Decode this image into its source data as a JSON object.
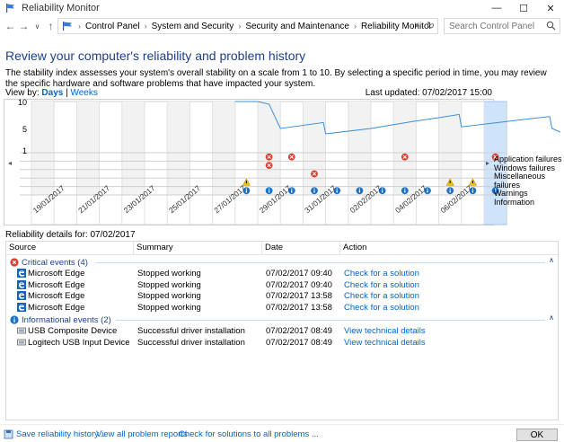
{
  "window": {
    "title": "Reliability Monitor"
  },
  "breadcrumb": [
    "Control Panel",
    "System and Security",
    "Security and Maintenance",
    "Reliability Monitor"
  ],
  "search": {
    "placeholder": "Search Control Panel"
  },
  "heading": "Review your computer's reliability and problem history",
  "description": "The stability index assesses your system's overall stability on a scale from 1 to 10. By selecting a specific period in time, you may review the specific hardware and software problems that have impacted your system.",
  "view_by": {
    "label": "View by:",
    "days": "Days",
    "separator": "|",
    "weeks": "Weeks"
  },
  "last_updated": "Last updated: 07/02/2017 15:00",
  "chart_data": {
    "type": "line",
    "y_ticks": [
      "10",
      "5",
      "1"
    ],
    "ylim": [
      1,
      10
    ],
    "x_labels": [
      "19/01/2017",
      "21/01/2017",
      "23/01/2017",
      "25/01/2017",
      "27/01/2017",
      "29/01/2017",
      "31/01/2017",
      "02/02/2017",
      "04/02/2017",
      "06/02/2017"
    ],
    "stability_index": [
      {
        "x": 9.0,
        "y": 10.0
      },
      {
        "x": 10.0,
        "y": 10.0
      },
      {
        "x": 10.5,
        "y": 9.5
      },
      {
        "x": 11.0,
        "y": 5.0
      },
      {
        "x": 12.9,
        "y": 6.1
      },
      {
        "x": 13.0,
        "y": 4.0
      },
      {
        "x": 15.0,
        "y": 5.0
      },
      {
        "x": 16.0,
        "y": 5.7
      },
      {
        "x": 17.0,
        "y": 6.4
      },
      {
        "x": 18.0,
        "y": 7.0
      },
      {
        "x": 18.9,
        "y": 7.6
      },
      {
        "x": 19.0,
        "y": 5.3
      },
      {
        "x": 21.0,
        "y": 6.3
      },
      {
        "x": 22.0,
        "y": 6.8
      },
      {
        "x": 22.9,
        "y": 7.2
      },
      {
        "x": 23.0,
        "y": 5.0
      },
      {
        "x": 23.5,
        "y": 4.1
      }
    ],
    "rows": [
      "Application failures",
      "Windows failures",
      "Miscellaneous failures",
      "Warnings",
      "Information"
    ],
    "events": [
      {
        "row": 0,
        "col": 10,
        "kind": "error"
      },
      {
        "row": 1,
        "col": 10,
        "kind": "error"
      },
      {
        "row": 0,
        "col": 11,
        "kind": "error"
      },
      {
        "row": 2,
        "col": 12,
        "kind": "error"
      },
      {
        "row": 0,
        "col": 16,
        "kind": "error"
      },
      {
        "row": 0,
        "col": 20,
        "kind": "error"
      },
      {
        "row": 3,
        "col": 9,
        "kind": "warning"
      },
      {
        "row": 3,
        "col": 18,
        "kind": "warning"
      },
      {
        "row": 3,
        "col": 19,
        "kind": "warning"
      },
      {
        "row": 4,
        "col": 9,
        "kind": "info"
      },
      {
        "row": 4,
        "col": 10,
        "kind": "info"
      },
      {
        "row": 4,
        "col": 11,
        "kind": "info"
      },
      {
        "row": 4,
        "col": 12,
        "kind": "info"
      },
      {
        "row": 4,
        "col": 13,
        "kind": "info"
      },
      {
        "row": 4,
        "col": 14,
        "kind": "info"
      },
      {
        "row": 4,
        "col": 15,
        "kind": "info"
      },
      {
        "row": 4,
        "col": 16,
        "kind": "info"
      },
      {
        "row": 4,
        "col": 17,
        "kind": "info"
      },
      {
        "row": 4,
        "col": 18,
        "kind": "info"
      },
      {
        "row": 4,
        "col": 19,
        "kind": "info"
      },
      {
        "row": 4,
        "col": 20,
        "kind": "info"
      }
    ],
    "selected_col": 20,
    "grid": true
  },
  "details_for": "Reliability details for: 07/02/2017",
  "table": {
    "headers": [
      "Source",
      "Summary",
      "Date",
      "Action"
    ],
    "critical_group": "Critical events (4)",
    "critical": [
      {
        "source": "Microsoft Edge",
        "summary": "Stopped working",
        "date": "07/02/2017 09:40",
        "action": "Check for a solution"
      },
      {
        "source": "Microsoft Edge",
        "summary": "Stopped working",
        "date": "07/02/2017 09:40",
        "action": "Check for a solution"
      },
      {
        "source": "Microsoft Edge",
        "summary": "Stopped working",
        "date": "07/02/2017 13:58",
        "action": "Check for a solution"
      },
      {
        "source": "Microsoft Edge",
        "summary": "Stopped working",
        "date": "07/02/2017 13:58",
        "action": "Check for a solution"
      }
    ],
    "info_group": "Informational events (2)",
    "info": [
      {
        "source": "USB Composite Device",
        "summary": "Successful driver installation",
        "date": "07/02/2017 08:49",
        "action": "View  technical details"
      },
      {
        "source": "Logitech USB Input Device",
        "summary": "Successful driver installation",
        "date": "07/02/2017 08:49",
        "action": "View  technical details"
      }
    ]
  },
  "footer": {
    "save": "Save reliability history...",
    "view_all": "View all problem reports",
    "check_all": "Check for solutions to all problems ...",
    "ok": "OK"
  },
  "colors": {
    "link": "#0066cc",
    "heading": "#1e3f8a",
    "line": "#3d8fd6",
    "error": "#d9402f",
    "warning": "#f2c200",
    "info": "#1a73c9",
    "selected": "#cfe3fb"
  }
}
